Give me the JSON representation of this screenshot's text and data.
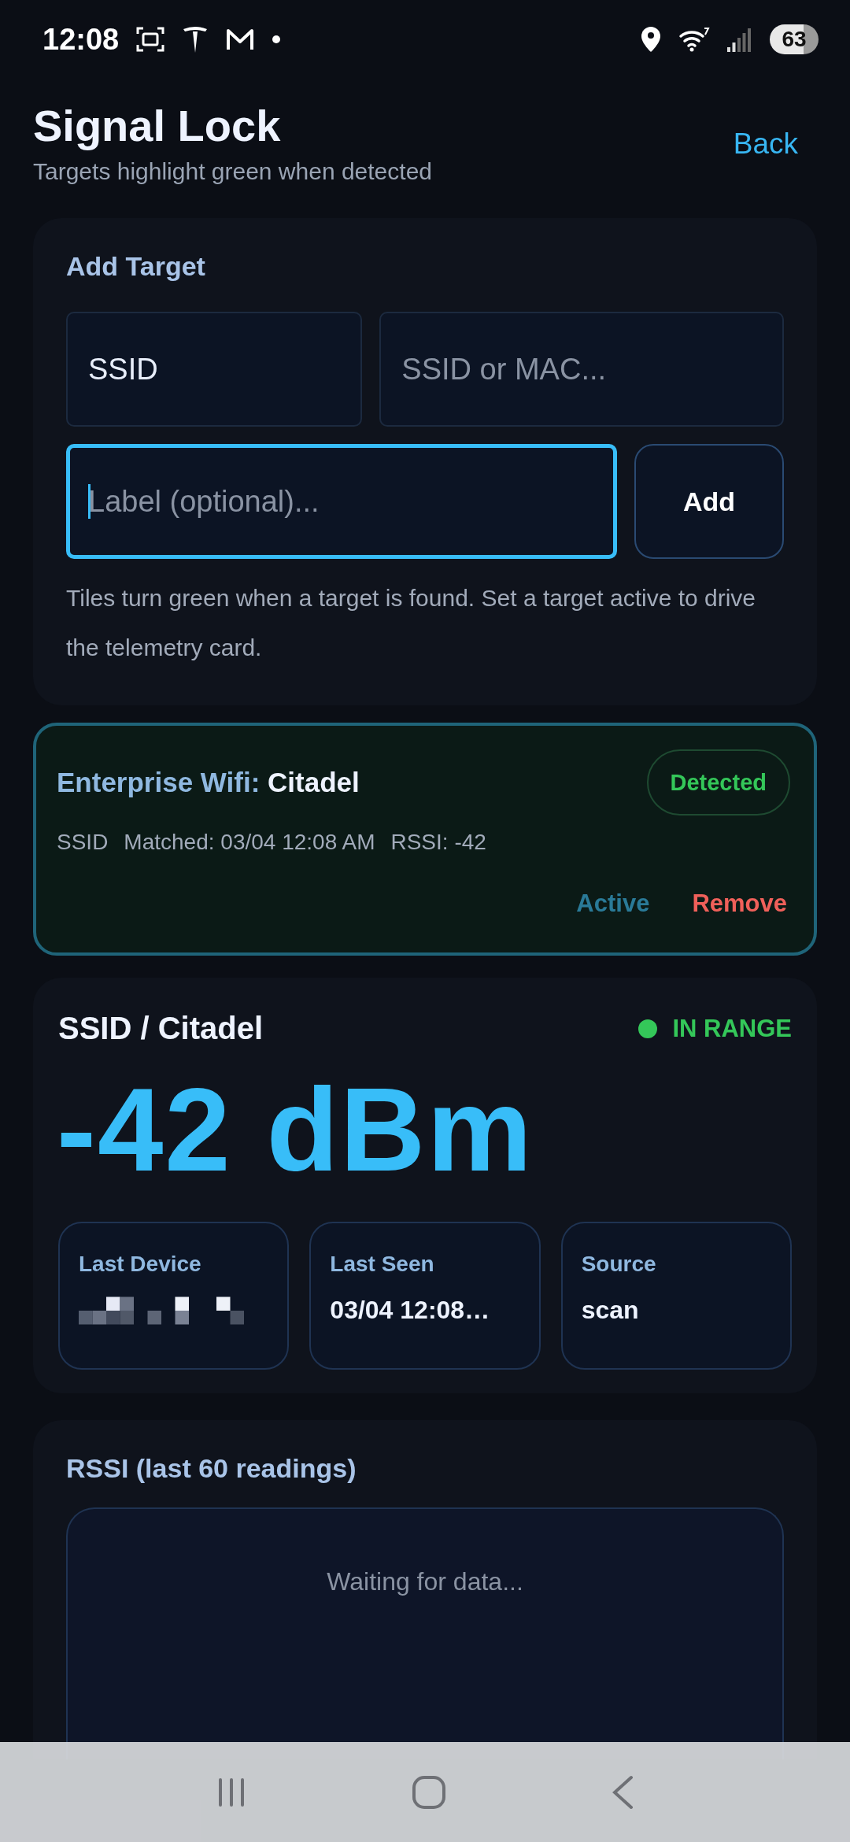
{
  "status_bar": {
    "time": "12:08",
    "battery": "63"
  },
  "header": {
    "title": "Signal Lock",
    "subtitle": "Targets highlight green when detected",
    "back": "Back"
  },
  "add_target": {
    "title": "Add Target",
    "type_select": {
      "value": "SSID"
    },
    "id_field": {
      "placeholder": "SSID or MAC..."
    },
    "label_field": {
      "placeholder": "Label (optional)...",
      "focused": true
    },
    "add_button": "Add",
    "help": "Tiles turn green when a target is found. Set a target active to drive the telemetry card."
  },
  "targets": [
    {
      "category": "Enterprise Wifi:",
      "name": "Citadel",
      "status": "Detected",
      "detected": true,
      "active": true,
      "meta": [
        "SSID",
        "Matched: 03/04 12:08 AM",
        "RSSI: -42"
      ],
      "active_label": "Active",
      "remove_label": "Remove"
    }
  ],
  "telemetry": {
    "title": "SSID / Citadel",
    "status": "IN RANGE",
    "in_range": true,
    "reading": "-42 dBm",
    "stats": [
      {
        "label": "Last Device",
        "kind": "redacted"
      },
      {
        "label": "Last Seen",
        "kind": "text",
        "value": "03/04 12:08…"
      },
      {
        "label": "Source",
        "kind": "text",
        "value": "scan"
      }
    ]
  },
  "chart": {
    "title": "RSSI (last 60 readings)",
    "empty_text": "Waiting for data..."
  }
}
